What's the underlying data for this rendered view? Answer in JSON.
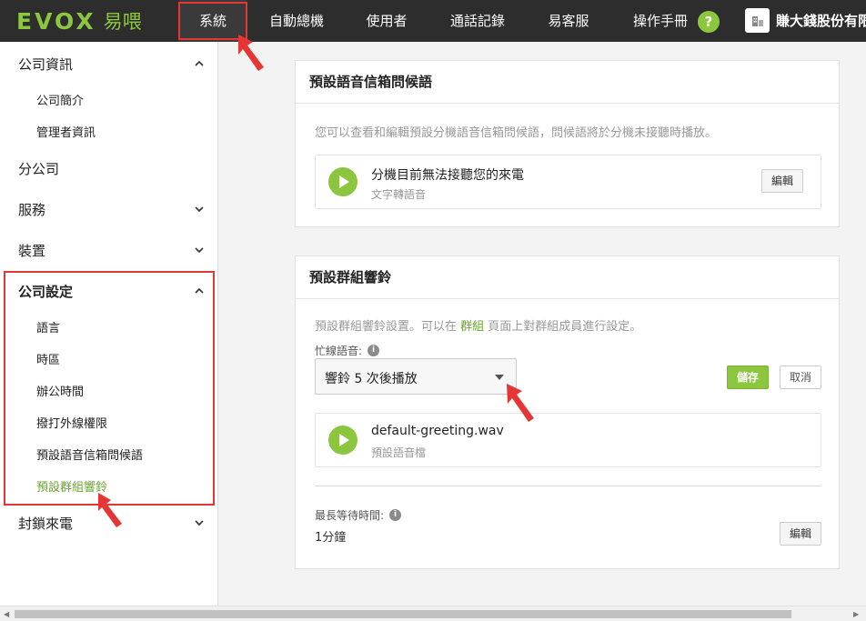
{
  "brand": {
    "logo_text": "EVOX",
    "logo_cn": "易喂"
  },
  "nav": {
    "items": [
      "系統",
      "自動總機",
      "使用者",
      "通話記錄",
      "易客服",
      "操作手冊"
    ],
    "help": "?",
    "company": "賺大錢股份有限公司"
  },
  "sidebar": {
    "company_info": "公司資訊",
    "company_profile": "公司簡介",
    "admin_info": "管理者資訊",
    "branch": "分公司",
    "services": "服務",
    "devices": "裝置",
    "company_settings": "公司設定",
    "language": "語言",
    "timezone": "時區",
    "office_hours": "辦公時間",
    "outbound_perm": "撥打外線權限",
    "default_voicemail": "預設語音信箱問候語",
    "default_ringtone": "預設群組響鈴",
    "block_calls": "封鎖來電"
  },
  "voicemail_card": {
    "title": "預設語音信箱問候語",
    "desc": "您可以查看和編輯預設分機語音信箱問候語，問候語將於分機未接聽時播放。",
    "audio_name": "分機目前無法接聽您的來電",
    "audio_type": "文字轉語音",
    "edit": "編輯"
  },
  "ringtone_card": {
    "title": "預設群組響鈴",
    "desc_before": "預設群組響鈴設置。可以在 ",
    "desc_link": "群組",
    "desc_after": " 頁面上對群組成員進行設定。",
    "busy_label": "忙線語音:",
    "info": "i",
    "select_value": "響鈴 5 次後播放",
    "save": "儲存",
    "cancel": "取消",
    "audio_name": "default-greeting.wav",
    "audio_type": "預設語音檔",
    "wait_label": "最長等待時間:",
    "wait_value": "1分鐘",
    "edit": "編輯"
  },
  "colors": {
    "accent": "#8cc63f",
    "highlight": "#e53535",
    "topbar": "#2d2d2d"
  }
}
